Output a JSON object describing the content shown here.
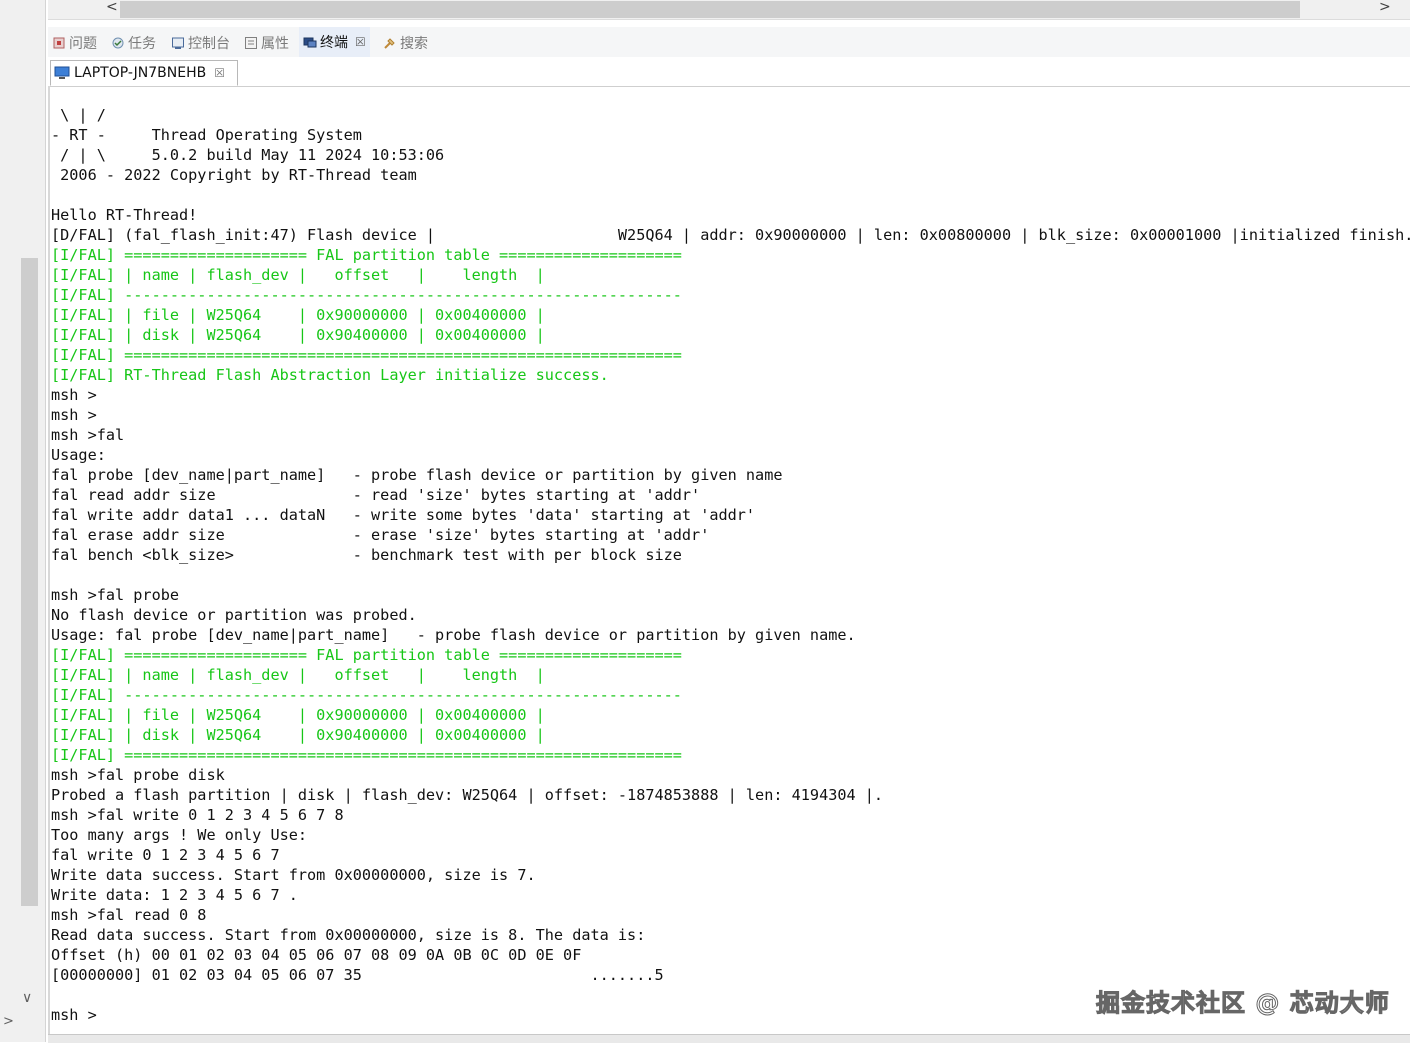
{
  "view_tabs": [
    {
      "label": "问题",
      "icon": "problems-icon"
    },
    {
      "label": "任务",
      "icon": "tasks-icon"
    },
    {
      "label": "控制台",
      "icon": "console-icon"
    },
    {
      "label": "属性",
      "icon": "properties-icon"
    },
    {
      "label": "终端",
      "icon": "terminal-icon",
      "active": true
    },
    {
      "label": "搜索",
      "icon": "search-icon"
    }
  ],
  "terminal_tab": {
    "label": "LAPTOP-JN7BNEHB",
    "close": "☒"
  },
  "scroll": {
    "left_arrow": "<",
    "right_arrow": ">",
    "down_arrow": "∨",
    "side_chevron": ">"
  },
  "terminal_lines": [
    {
      "text": " \\ | /",
      "color": "normal"
    },
    {
      "text": "- RT -     Thread Operating System",
      "color": "normal"
    },
    {
      "text": " / | \\     5.0.2 build May 11 2024 10:53:06",
      "color": "normal"
    },
    {
      "text": " 2006 - 2022 Copyright by RT-Thread team",
      "color": "normal"
    },
    {
      "text": "",
      "color": "normal"
    },
    {
      "text": "Hello RT-Thread!",
      "color": "normal"
    },
    {
      "text": "[D/FAL] (fal_flash_init:47) Flash device |                    W25Q64 | addr: 0x90000000 | len: 0x00800000 | blk_size: 0x00001000 |initialized finish.",
      "color": "normal"
    },
    {
      "text": "[I/FAL] ==================== FAL partition table ====================",
      "color": "green"
    },
    {
      "text": "[I/FAL] | name | flash_dev |   offset   |    length  |",
      "color": "green"
    },
    {
      "text": "[I/FAL] -------------------------------------------------------------",
      "color": "green"
    },
    {
      "text": "[I/FAL] | file | W25Q64    | 0x90000000 | 0x00400000 |",
      "color": "green"
    },
    {
      "text": "[I/FAL] | disk | W25Q64    | 0x90400000 | 0x00400000 |",
      "color": "green"
    },
    {
      "text": "[I/FAL] =============================================================",
      "color": "green"
    },
    {
      "text": "[I/FAL] RT-Thread Flash Abstraction Layer initialize success.",
      "color": "green"
    },
    {
      "text": "msh >",
      "color": "normal"
    },
    {
      "text": "msh >",
      "color": "normal"
    },
    {
      "text": "msh >fal",
      "color": "normal"
    },
    {
      "text": "Usage:",
      "color": "normal"
    },
    {
      "text": "fal probe [dev_name|part_name]   - probe flash device or partition by given name",
      "color": "normal"
    },
    {
      "text": "fal read addr size               - read 'size' bytes starting at 'addr'",
      "color": "normal"
    },
    {
      "text": "fal write addr data1 ... dataN   - write some bytes 'data' starting at 'addr'",
      "color": "normal"
    },
    {
      "text": "fal erase addr size              - erase 'size' bytes starting at 'addr'",
      "color": "normal"
    },
    {
      "text": "fal bench <blk_size>             - benchmark test with per block size",
      "color": "normal"
    },
    {
      "text": "",
      "color": "normal"
    },
    {
      "text": "msh >fal probe",
      "color": "normal"
    },
    {
      "text": "No flash device or partition was probed.",
      "color": "normal"
    },
    {
      "text": "Usage: fal probe [dev_name|part_name]   - probe flash device or partition by given name.",
      "color": "normal"
    },
    {
      "text": "[I/FAL] ==================== FAL partition table ====================",
      "color": "green"
    },
    {
      "text": "[I/FAL] | name | flash_dev |   offset   |    length  |",
      "color": "green"
    },
    {
      "text": "[I/FAL] -------------------------------------------------------------",
      "color": "green"
    },
    {
      "text": "[I/FAL] | file | W25Q64    | 0x90000000 | 0x00400000 |",
      "color": "green"
    },
    {
      "text": "[I/FAL] | disk | W25Q64    | 0x90400000 | 0x00400000 |",
      "color": "green"
    },
    {
      "text": "[I/FAL] =============================================================",
      "color": "green"
    },
    {
      "text": "msh >fal probe disk",
      "color": "normal"
    },
    {
      "text": "Probed a flash partition | disk | flash_dev: W25Q64 | offset: -1874853888 | len: 4194304 |.",
      "color": "normal"
    },
    {
      "text": "msh >fal write 0 1 2 3 4 5 6 7 8",
      "color": "normal"
    },
    {
      "text": "Too many args ! We only Use:",
      "color": "normal"
    },
    {
      "text": "fal write 0 1 2 3 4 5 6 7",
      "color": "normal"
    },
    {
      "text": "Write data success. Start from 0x00000000, size is 7.",
      "color": "normal"
    },
    {
      "text": "Write data: 1 2 3 4 5 6 7 .",
      "color": "normal"
    },
    {
      "text": "msh >fal read 0 8",
      "color": "normal"
    },
    {
      "text": "Read data success. Start from 0x00000000, size is 8. The data is:",
      "color": "normal"
    },
    {
      "text": "Offset (h) 00 01 02 03 04 05 06 07 08 09 0A 0B 0C 0D 0E 0F",
      "color": "normal"
    },
    {
      "text": "[00000000] 01 02 03 04 05 06 07 35                         .......5",
      "color": "normal"
    },
    {
      "text": "",
      "color": "normal"
    },
    {
      "text": "msh >",
      "color": "normal"
    }
  ],
  "watermark": "掘金技术社区 @ 芯动大师",
  "colors": {
    "green_log": "#17c617",
    "text": "#111111",
    "tab_active_bg": "#e8eef8"
  }
}
